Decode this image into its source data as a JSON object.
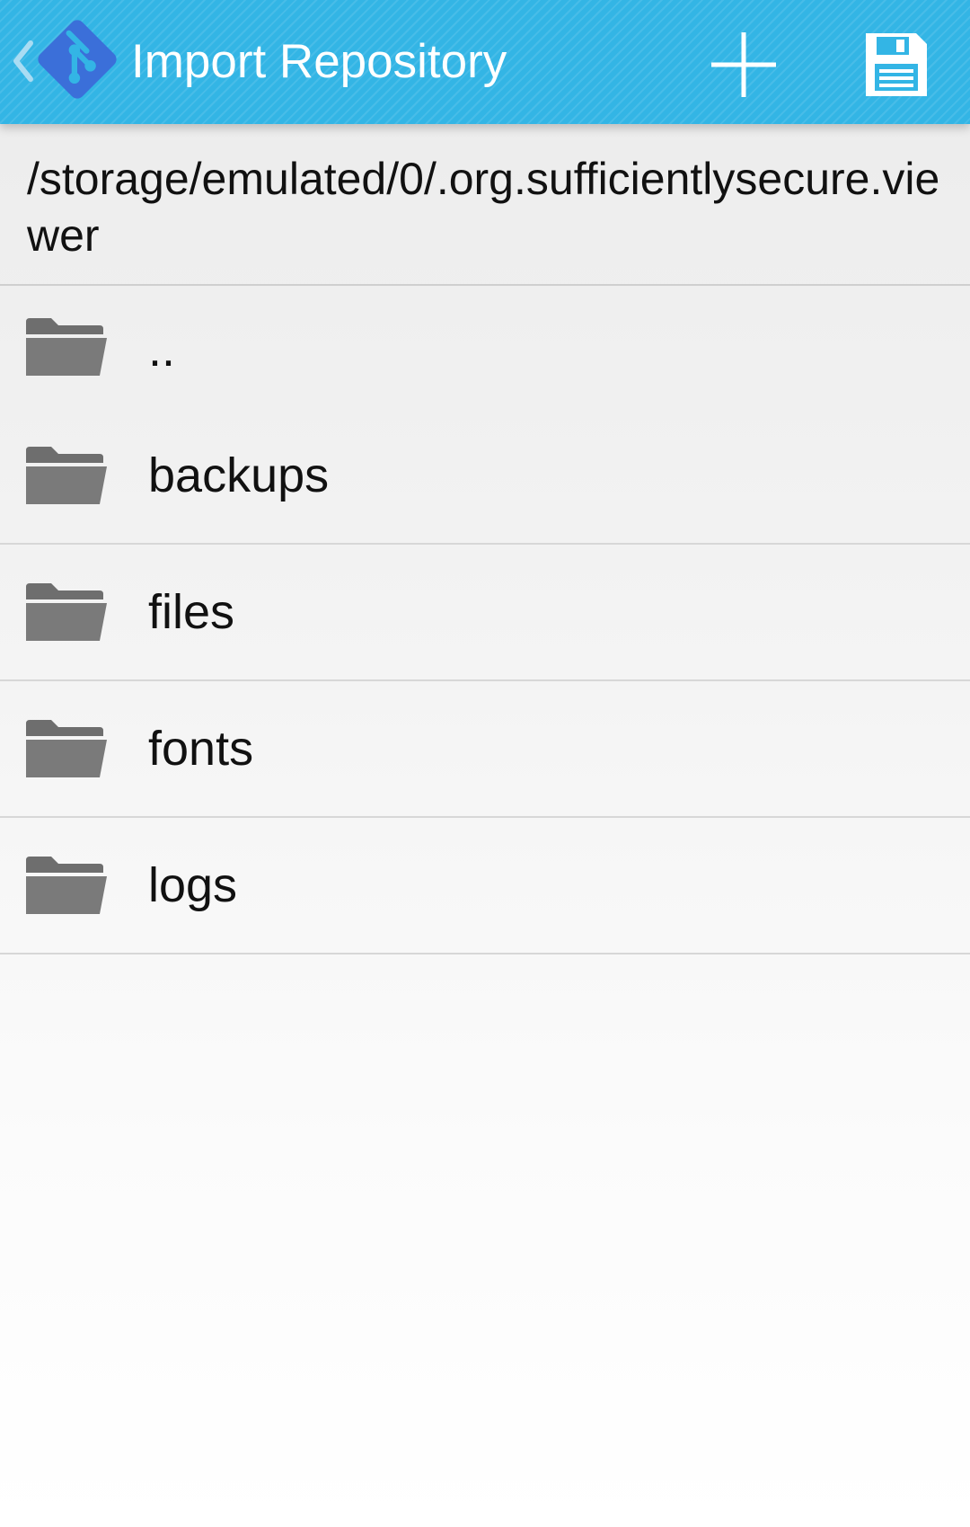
{
  "action_bar": {
    "title": "Import Repository",
    "up_icon": "chevron-left-icon",
    "logo_icon": "git-logo-icon",
    "actions": [
      {
        "name": "add-button",
        "icon": "plus-icon"
      },
      {
        "name": "save-button",
        "icon": "floppy-disk-icon"
      }
    ]
  },
  "current_path": "/storage/emulated/0/.org.sufficientlysecure.viewer",
  "folders": [
    {
      "label": "..",
      "icon": "folder-icon"
    },
    {
      "label": "backups",
      "icon": "folder-icon"
    },
    {
      "label": "files",
      "icon": "folder-icon"
    },
    {
      "label": "fonts",
      "icon": "folder-icon"
    },
    {
      "label": "logs",
      "icon": "folder-icon"
    }
  ],
  "colors": {
    "action_bar": "#33b5e5",
    "logo": "#3b6fd9",
    "folder_icon": "#6e6e6e",
    "text": "#111111"
  }
}
